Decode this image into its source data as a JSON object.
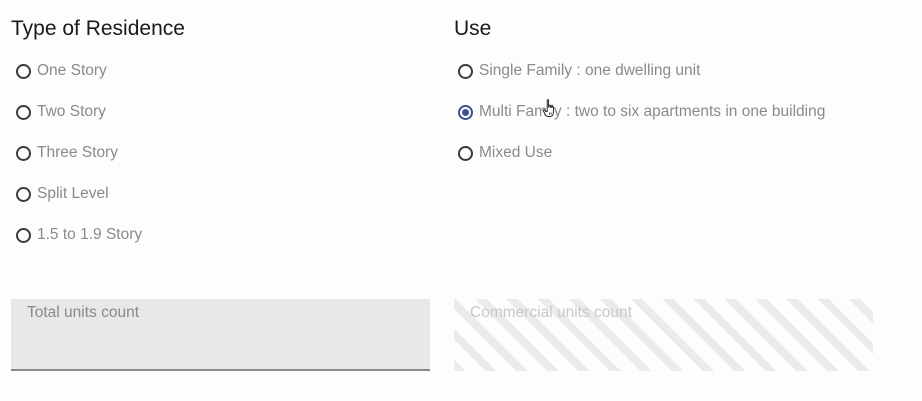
{
  "residence": {
    "title": "Type of Residence",
    "options": [
      {
        "label": "One Story"
      },
      {
        "label": "Two Story"
      },
      {
        "label": "Three Story"
      },
      {
        "label": "Split Level"
      },
      {
        "label": "1.5 to 1.9 Story"
      }
    ]
  },
  "use": {
    "title": "Use",
    "selected_index": 1,
    "options": [
      {
        "label": "Single Family : one dwelling unit"
      },
      {
        "label": "Multi Family : two to six apartments in one building"
      },
      {
        "label": "Mixed Use"
      }
    ]
  },
  "fields": {
    "total_units": {
      "label": "Total units count"
    },
    "commercial_units": {
      "label": "Commercial units count",
      "disabled": true
    }
  },
  "colors": {
    "accent": "#3d4f8e",
    "label_text": "#8a8a8a",
    "field_bg": "#e8e8ea"
  },
  "icons": {
    "cursor": "hand-pointer-icon"
  }
}
